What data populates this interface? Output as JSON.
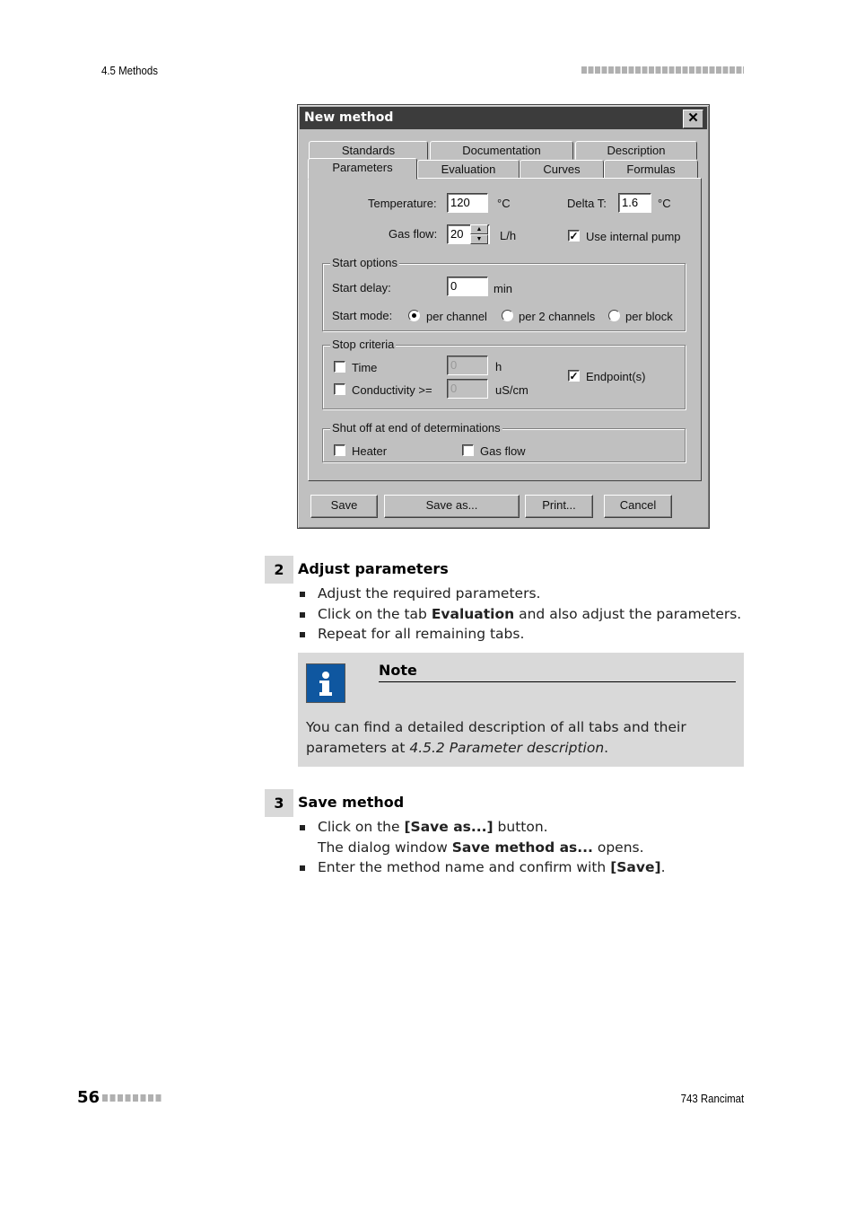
{
  "header": {
    "section": "4.5 Methods"
  },
  "footer": {
    "page_number": "56",
    "product": "743 Rancimat"
  },
  "dialog": {
    "title": "New method",
    "close_icon": "close-icon",
    "tabs_back": [
      "Standards",
      "Documentation",
      "Description"
    ],
    "tabs_front": [
      "Parameters",
      "Evaluation",
      "Curves",
      "Formulas"
    ],
    "active_tab": "Parameters",
    "temperature": {
      "label": "Temperature:",
      "value": "120",
      "unit": "°C"
    },
    "delta_t": {
      "label": "Delta T:",
      "value": "1.6",
      "unit": "°C"
    },
    "gas_flow": {
      "label": "Gas flow:",
      "value": "20",
      "unit": "L/h"
    },
    "use_internal_pump": {
      "label": "Use internal pump",
      "checked": true
    },
    "start_options": {
      "legend": "Start options",
      "start_delay": {
        "label": "Start delay:",
        "value": "0",
        "unit": "min"
      },
      "start_mode": {
        "label": "Start mode:",
        "options": [
          "per channel",
          "per 2 channels",
          "per block"
        ],
        "selected": "per channel"
      }
    },
    "stop_criteria": {
      "legend": "Stop criteria",
      "time": {
        "label": "Time",
        "checked": false,
        "value": "0",
        "unit": "h"
      },
      "conductivity": {
        "label": "Conductivity  >=",
        "checked": false,
        "value": "0",
        "unit": "uS/cm"
      },
      "endpoints": {
        "label": "Endpoint(s)",
        "checked": true
      }
    },
    "shut_off": {
      "legend": "Shut off at end of determinations",
      "heater": {
        "label": "Heater",
        "checked": false
      },
      "gas_flow": {
        "label": "Gas flow",
        "checked": false
      }
    },
    "buttons": {
      "save": "Save",
      "save_as": "Save as...",
      "print": "Print...",
      "cancel": "Cancel"
    }
  },
  "steps": [
    {
      "number": "2",
      "title": "Adjust parameters",
      "bullets": [
        {
          "text": "Adjust the required parameters."
        },
        {
          "pre": "Click on the tab ",
          "bold": "Evaluation",
          "post": " and also adjust the parameters."
        },
        {
          "text": "Repeat for all remaining tabs."
        }
      ]
    },
    {
      "number": "3",
      "title": "Save method",
      "bullets": [
        {
          "pre": "Click on the ",
          "bold": "[Save as...]",
          "post": " button.",
          "sub_pre": "The dialog window ",
          "sub_bold": "Save method as...",
          "sub_post": " opens."
        },
        {
          "pre": "Enter the method name and confirm with ",
          "bold": "[Save]",
          "post": "."
        }
      ]
    }
  ],
  "note": {
    "icon": "info-icon",
    "title": "Note",
    "text_pre": "You can find a detailed description of all tabs and their parameters at ",
    "text_italic": "4.5.2 Parameter description",
    "text_post": "."
  }
}
